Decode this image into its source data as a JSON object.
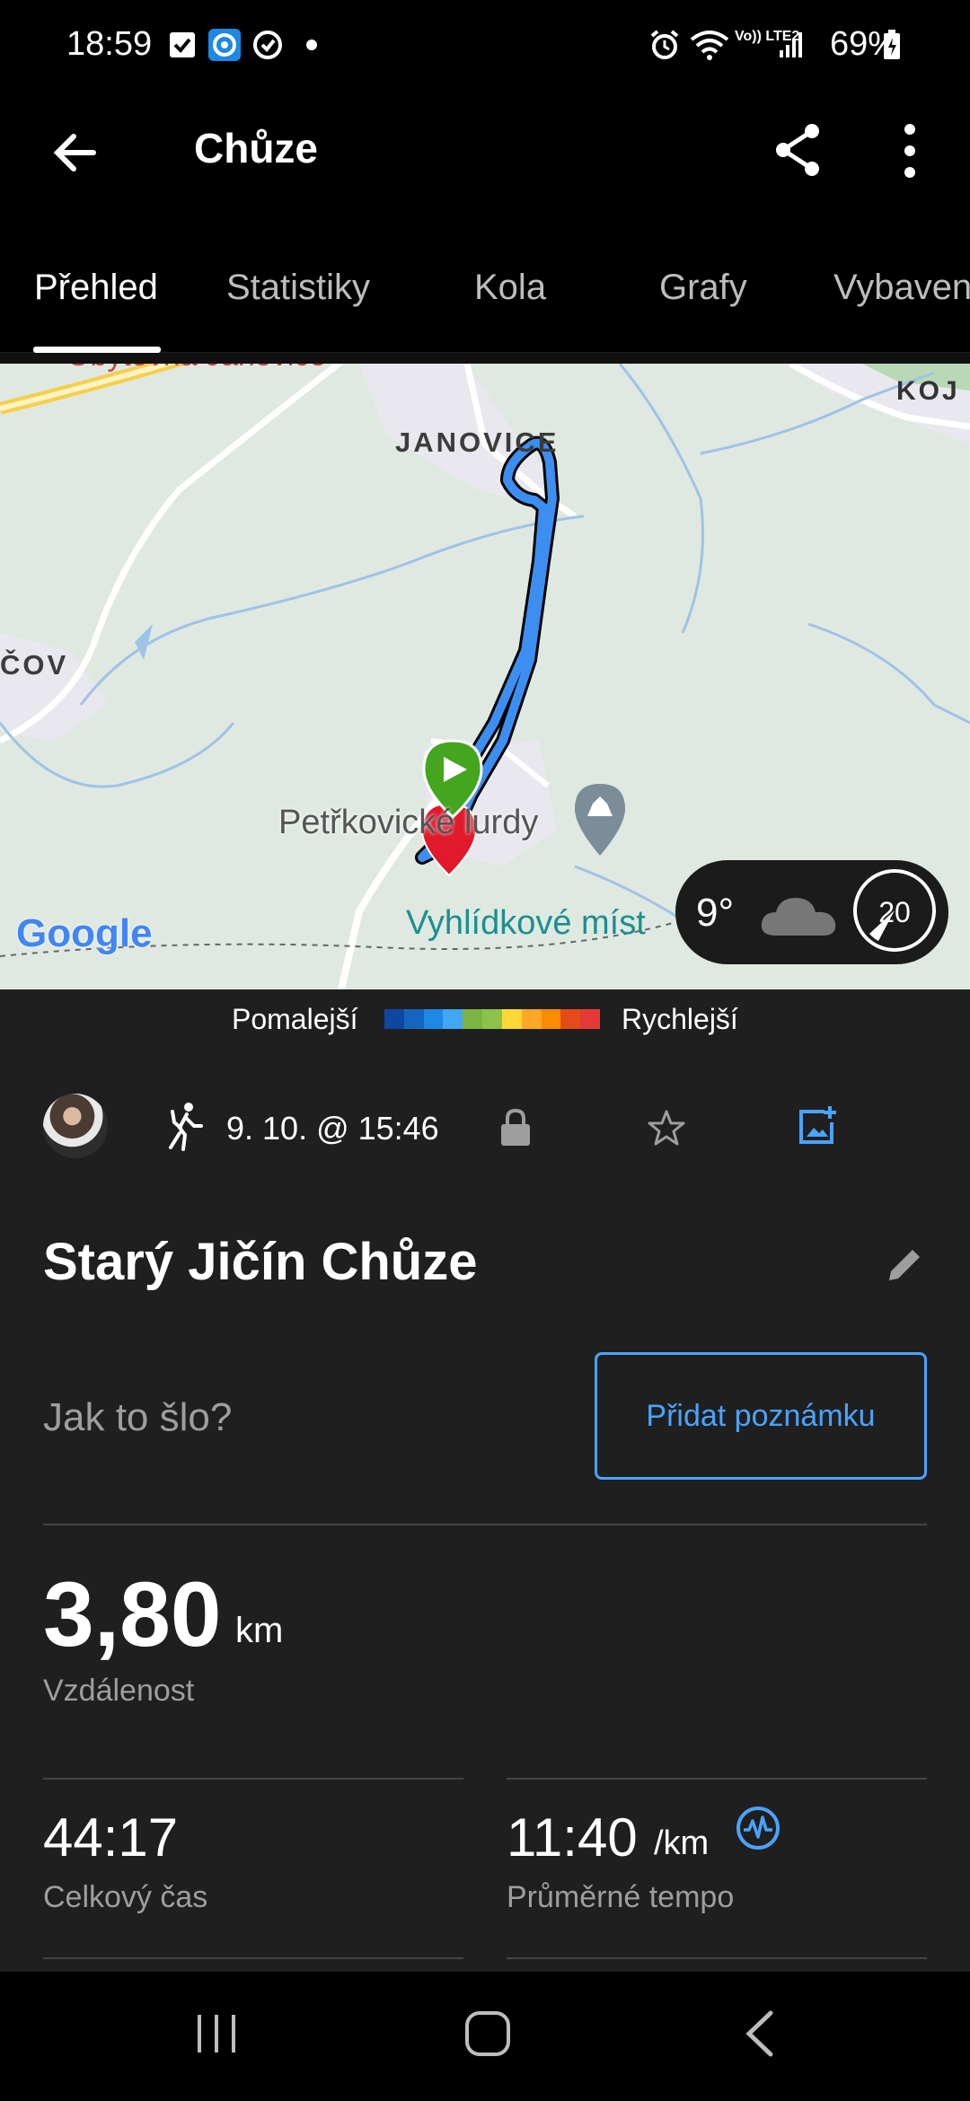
{
  "status_bar": {
    "time": "18:59",
    "battery": "69%",
    "icons": [
      "check-icon",
      "app-icon",
      "sync-icon",
      "dot-icon",
      "alarm-icon",
      "wifi-icon",
      "volte-icon",
      "signal-icon",
      "battery-icon"
    ],
    "volte_text": "Vo)) LTE2"
  },
  "app_bar": {
    "title": "Chůze",
    "icons": [
      "back-arrow-icon",
      "share-icon",
      "more-vert-icon"
    ]
  },
  "tabs": [
    {
      "label": "Přehled",
      "active": true
    },
    {
      "label": "Statistiky",
      "active": false
    },
    {
      "label": "Kola",
      "active": false
    },
    {
      "label": "Grafy",
      "active": false
    },
    {
      "label": "Vybaven",
      "active": false
    }
  ],
  "map": {
    "labels": {
      "top_left": "Obytovna Janovice",
      "kojetin": "KOJ",
      "janovice": "JANOVICE",
      "cov": "ČOV",
      "petrkovicke": "Petřkovické lurdy",
      "vyhlidkove": "Vyhlídkové míst"
    },
    "logo": "Google",
    "route_color": "#3c8ef0",
    "start_marker_color": "#43a61e",
    "end_marker_color": "#e0192b"
  },
  "weather": {
    "temperature": "9°",
    "icon": "cloud-icon",
    "wind": "20"
  },
  "legend": {
    "slower": "Pomalejší",
    "faster": "Rychlejší",
    "colors": [
      "#0d47a1",
      "#1565c0",
      "#1e88e5",
      "#42a5f5",
      "#7cb342",
      "#8bc34a",
      "#fdd835",
      "#ffa726",
      "#fb8c00",
      "#e64a19",
      "#e53935"
    ]
  },
  "activity": {
    "type_icon": "walk-icon",
    "date": "9. 10. @ 15:46",
    "title": "Starý Jičín Chůze",
    "question": "Jak to šlo?",
    "add_note": "Přidat poznámku"
  },
  "stats": {
    "distance": {
      "value": "3,80",
      "unit": "km",
      "label": "Vzdálenost"
    },
    "total_time": {
      "value": "44:17",
      "label": "Celkový čas"
    },
    "avg_pace": {
      "value": "11:40",
      "unit": "/km",
      "label": "Průměrné tempo"
    }
  },
  "nav_bar": {
    "icons": [
      "recents-icon",
      "home-icon",
      "back-icon"
    ]
  }
}
